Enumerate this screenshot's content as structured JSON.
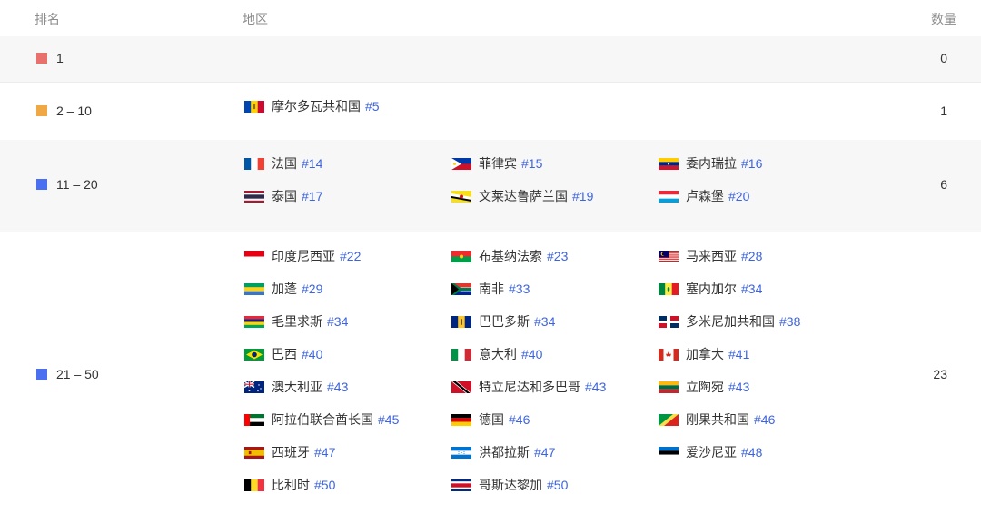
{
  "header": {
    "rank": "排名",
    "region": "地区",
    "count": "数量"
  },
  "colors": {
    "r1": "#e8706d",
    "r2": "#f0a845",
    "r3": "#4a6ff0",
    "r4": "#4a6ff0",
    "link": "#3c63e0"
  },
  "rows": [
    {
      "rank": "1",
      "count": "0",
      "items": []
    },
    {
      "rank": "2 – 10",
      "count": "1",
      "items": [
        {
          "name": "摩尔多瓦共和国",
          "num": "#5",
          "flag": "moldova-flag-icon"
        }
      ]
    },
    {
      "rank": "11 – 20",
      "count": "6",
      "items": [
        {
          "name": "法国",
          "num": "#14",
          "flag": "france-flag-icon"
        },
        {
          "name": "菲律宾",
          "num": "#15",
          "flag": "philippines-flag-icon"
        },
        {
          "name": "委内瑞拉",
          "num": "#16",
          "flag": "venezuela-flag-icon"
        },
        {
          "name": "泰国",
          "num": "#17",
          "flag": "thailand-flag-icon"
        },
        {
          "name": "文莱达鲁萨兰国",
          "num": "#19",
          "flag": "brunei-flag-icon"
        },
        {
          "name": "卢森堡",
          "num": "#20",
          "flag": "luxembourg-flag-icon"
        }
      ]
    },
    {
      "rank": "21 – 50",
      "count": "23",
      "items": [
        {
          "name": "印度尼西亚",
          "num": "#22",
          "flag": "indonesia-flag-icon"
        },
        {
          "name": "布基纳法索",
          "num": "#23",
          "flag": "burkina-faso-flag-icon"
        },
        {
          "name": "马来西亚",
          "num": "#28",
          "flag": "malaysia-flag-icon"
        },
        {
          "name": "加蓬",
          "num": "#29",
          "flag": "gabon-flag-icon"
        },
        {
          "name": "南非",
          "num": "#33",
          "flag": "south-africa-flag-icon"
        },
        {
          "name": "塞内加尔",
          "num": "#34",
          "flag": "senegal-flag-icon"
        },
        {
          "name": "毛里求斯",
          "num": "#34",
          "flag": "mauritius-flag-icon"
        },
        {
          "name": "巴巴多斯",
          "num": "#34",
          "flag": "barbados-flag-icon"
        },
        {
          "name": "多米尼加共和国",
          "num": "#38",
          "flag": "dominican-republic-flag-icon"
        },
        {
          "name": "巴西",
          "num": "#40",
          "flag": "brazil-flag-icon"
        },
        {
          "name": "意大利",
          "num": "#40",
          "flag": "italy-flag-icon"
        },
        {
          "name": "加拿大",
          "num": "#41",
          "flag": "canada-flag-icon"
        },
        {
          "name": "澳大利亚",
          "num": "#43",
          "flag": "australia-flag-icon"
        },
        {
          "name": "特立尼达和多巴哥",
          "num": "#43",
          "flag": "trinidad-flag-icon"
        },
        {
          "name": "立陶宛",
          "num": "#43",
          "flag": "lithuania-flag-icon"
        },
        {
          "name": "阿拉伯联合酋长国",
          "num": "#45",
          "flag": "uae-flag-icon"
        },
        {
          "name": "德国",
          "num": "#46",
          "flag": "germany-flag-icon"
        },
        {
          "name": "刚果共和国",
          "num": "#46",
          "flag": "congo-flag-icon"
        },
        {
          "name": "西班牙",
          "num": "#47",
          "flag": "spain-flag-icon"
        },
        {
          "name": "洪都拉斯",
          "num": "#47",
          "flag": "honduras-flag-icon"
        },
        {
          "name": "爱沙尼亚",
          "num": "#48",
          "flag": "estonia-flag-icon"
        },
        {
          "name": "比利时",
          "num": "#50",
          "flag": "belgium-flag-icon"
        },
        {
          "name": "哥斯达黎加",
          "num": "#50",
          "flag": "costa-rica-flag-icon"
        }
      ]
    }
  ]
}
